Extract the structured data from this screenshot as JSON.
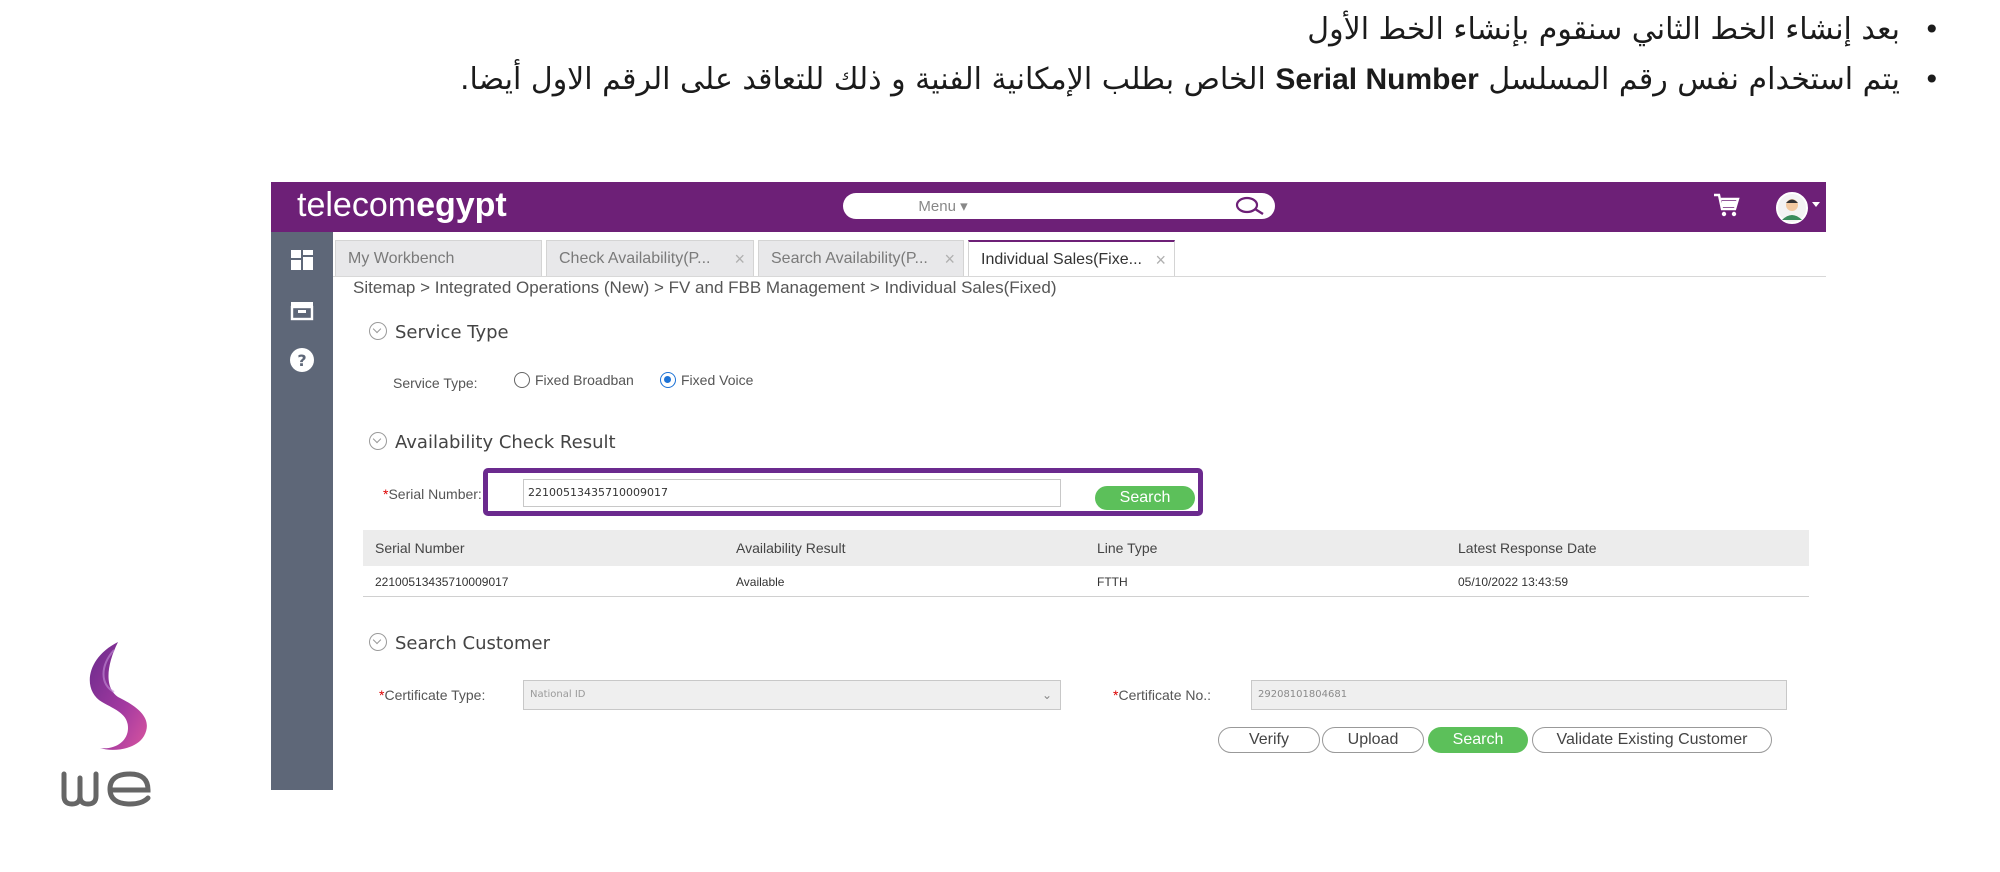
{
  "bullets": {
    "line1": "بعد إنشاء الخط الثاني سنقوم بإنشاء الخط الأول",
    "line2_pre": "يتم استخدام نفس رقم المسلسل ",
    "line2_latin": "Serial Number",
    "line2_post": " الخاص بطلب الإمكانية الفنية و ذلك للتعاقد على الرقم الاول أيضا."
  },
  "header": {
    "logo_light": "telecom",
    "logo_bold": "egypt",
    "menu_label": "Menu ▾",
    "brand_color": "#6d2077"
  },
  "sidenav": {
    "icons": [
      "dashboard-icon",
      "inbox-icon",
      "help-icon"
    ]
  },
  "tabs": [
    {
      "label": "My Workbench",
      "closable": false
    },
    {
      "label": "Check Availability(P...",
      "closable": true
    },
    {
      "label": "Search Availability(P...",
      "closable": true
    },
    {
      "label": "Individual Sales(Fixe...",
      "closable": true,
      "active": true
    }
  ],
  "breadcrumb": "Sitemap > Integrated Operations (New) > FV and FBB Management > Individual Sales(Fixed)",
  "service_type": {
    "section_title": "Service Type",
    "field_label": "Service Type:",
    "options": [
      "Fixed Broadban",
      "Fixed Voice"
    ],
    "selected": "Fixed Voice"
  },
  "availability": {
    "section_title": "Availability Check Result",
    "field_label": "Serial Number:",
    "value": "22100513435710009017",
    "search_label": "Search",
    "columns": [
      "Serial Number",
      "Availability Result",
      "Line Type",
      "Latest Response Date"
    ],
    "rows": [
      [
        "22100513435710009017",
        "Available",
        "FTTH",
        "05/10/2022 13:43:59"
      ]
    ]
  },
  "search_customer": {
    "section_title": "Search Customer",
    "cert_type_label": "Certificate Type:",
    "cert_type_value": "National ID",
    "cert_no_label": "Certificate No.:",
    "cert_no_value": "29208101804681",
    "buttons": {
      "verify": "Verify",
      "upload": "Upload",
      "search": "Search",
      "validate": "Validate Existing Customer"
    }
  },
  "we_logo_text": "WE"
}
